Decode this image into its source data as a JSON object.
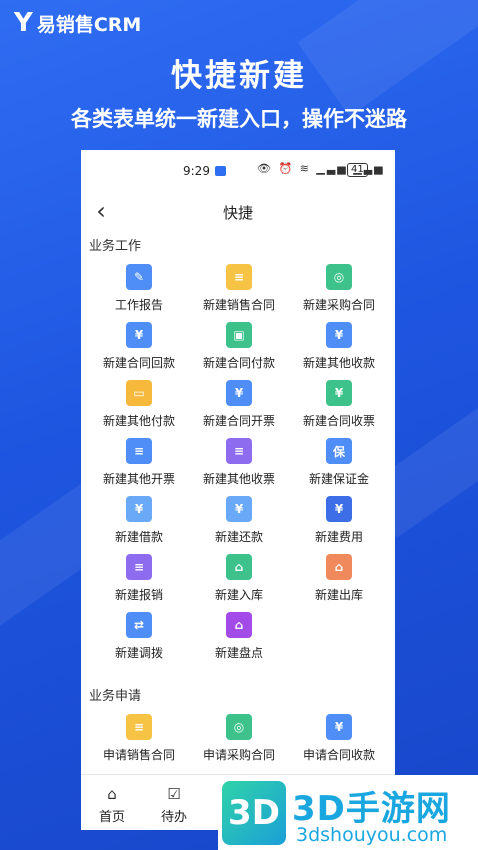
{
  "brand": {
    "mark": "Y",
    "name": "易销售CRM"
  },
  "hero": {
    "title": "快捷新建",
    "subtitle": "各类表单统一新建入口，操作不迷路"
  },
  "status_bar": {
    "time": "9:29",
    "icons": "👁 ⏰ ≋ ▁▃▅ ▁▃▅",
    "battery": "41"
  },
  "nav": {
    "title": "快捷",
    "back_icon": "chevron-left-icon"
  },
  "sections": [
    {
      "title": "业务工作",
      "items": [
        {
          "label": "工作报告",
          "icon": "report-icon",
          "color": "#4f8ef7",
          "glyph": "✎"
        },
        {
          "label": "新建销售合同",
          "icon": "sales-contract-icon",
          "color": "#f6c344",
          "glyph": "≡"
        },
        {
          "label": "新建采购合同",
          "icon": "purchase-contract-icon",
          "color": "#3cc28a",
          "glyph": "◎"
        },
        {
          "label": "新建合同回款",
          "icon": "contract-receipt-icon",
          "color": "#4f8ef7",
          "glyph": "¥"
        },
        {
          "label": "新建合同付款",
          "icon": "contract-payment-icon",
          "color": "#3cc28a",
          "glyph": "▣"
        },
        {
          "label": "新建其他收款",
          "icon": "other-receipt-icon",
          "color": "#4f8ef7",
          "glyph": "¥"
        },
        {
          "label": "新建其他付款",
          "icon": "other-payment-icon",
          "color": "#f6b93b",
          "glyph": "▭"
        },
        {
          "label": "新建合同开票",
          "icon": "contract-invoice-icon",
          "color": "#4f8ef7",
          "glyph": "¥"
        },
        {
          "label": "新建合同收票",
          "icon": "contract-receive-invoice-icon",
          "color": "#3cc28a",
          "glyph": "¥"
        },
        {
          "label": "新建其他开票",
          "icon": "other-invoice-icon",
          "color": "#4f8ef7",
          "glyph": "≡"
        },
        {
          "label": "新建其他收票",
          "icon": "other-receive-invoice-icon",
          "color": "#8e6cf0",
          "glyph": "≡"
        },
        {
          "label": "新建保证金",
          "icon": "deposit-icon",
          "color": "#4f8ef7",
          "glyph": "保"
        },
        {
          "label": "新建借款",
          "icon": "loan-icon",
          "color": "#6aa8f8",
          "glyph": "¥"
        },
        {
          "label": "新建还款",
          "icon": "repayment-icon",
          "color": "#6aa8f8",
          "glyph": "¥"
        },
        {
          "label": "新建费用",
          "icon": "expense-bag-icon",
          "color": "#3d6ee8",
          "glyph": "¥"
        },
        {
          "label": "新建报销",
          "icon": "reimbursement-icon",
          "color": "#8e6cf0",
          "glyph": "≡"
        },
        {
          "label": "新建入库",
          "icon": "stock-in-icon",
          "color": "#3cc28a",
          "glyph": "⌂"
        },
        {
          "label": "新建出库",
          "icon": "stock-out-icon",
          "color": "#f08a5d",
          "glyph": "⌂"
        },
        {
          "label": "新建调拨",
          "icon": "transfer-icon",
          "color": "#4f8ef7",
          "glyph": "⇄"
        },
        {
          "label": "新建盘点",
          "icon": "inventory-check-icon",
          "color": "#a24be8",
          "glyph": "⌂"
        }
      ]
    },
    {
      "title": "业务申请",
      "items": [
        {
          "label": "申请销售合同",
          "icon": "apply-sales-contract-icon",
          "color": "#f6c344",
          "glyph": "≡"
        },
        {
          "label": "申请采购合同",
          "icon": "apply-purchase-contract-icon",
          "color": "#3cc28a",
          "glyph": "◎"
        },
        {
          "label": "申请合同收款",
          "icon": "apply-contract-receipt-icon",
          "color": "#4f8ef7",
          "glyph": "¥"
        }
      ]
    }
  ],
  "tabs": [
    {
      "label": "首页",
      "icon": "home-icon",
      "glyph": "⌂"
    },
    {
      "label": "待办",
      "icon": "todo-icon",
      "glyph": "☑"
    }
  ],
  "watermark": {
    "logo": "3D",
    "name": "3D手游网",
    "url": "3dshouyou.com"
  }
}
